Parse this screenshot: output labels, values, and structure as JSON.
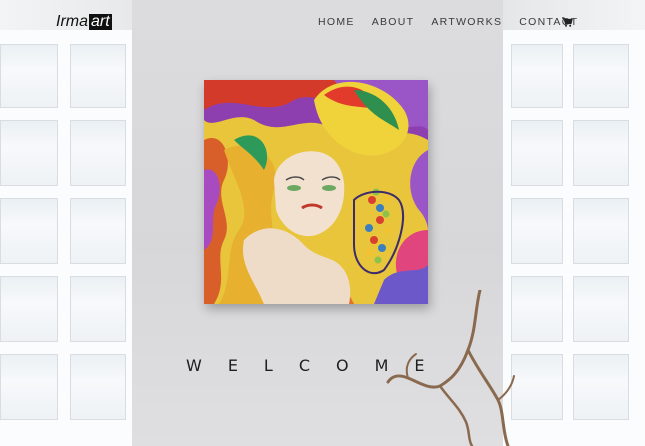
{
  "brand": {
    "logo_part1": "Irma",
    "logo_part2": "art"
  },
  "nav": {
    "items": [
      "HOME",
      "ABOUT",
      "ARTWORKS",
      "CONTACT"
    ]
  },
  "icons": {
    "cart": "shopping-cart-icon"
  },
  "hero": {
    "welcome_text": "WELCOME"
  },
  "colors": {
    "text": "#1f1f1f",
    "logo_bg": "#111111",
    "wall": "#d8d8da"
  }
}
